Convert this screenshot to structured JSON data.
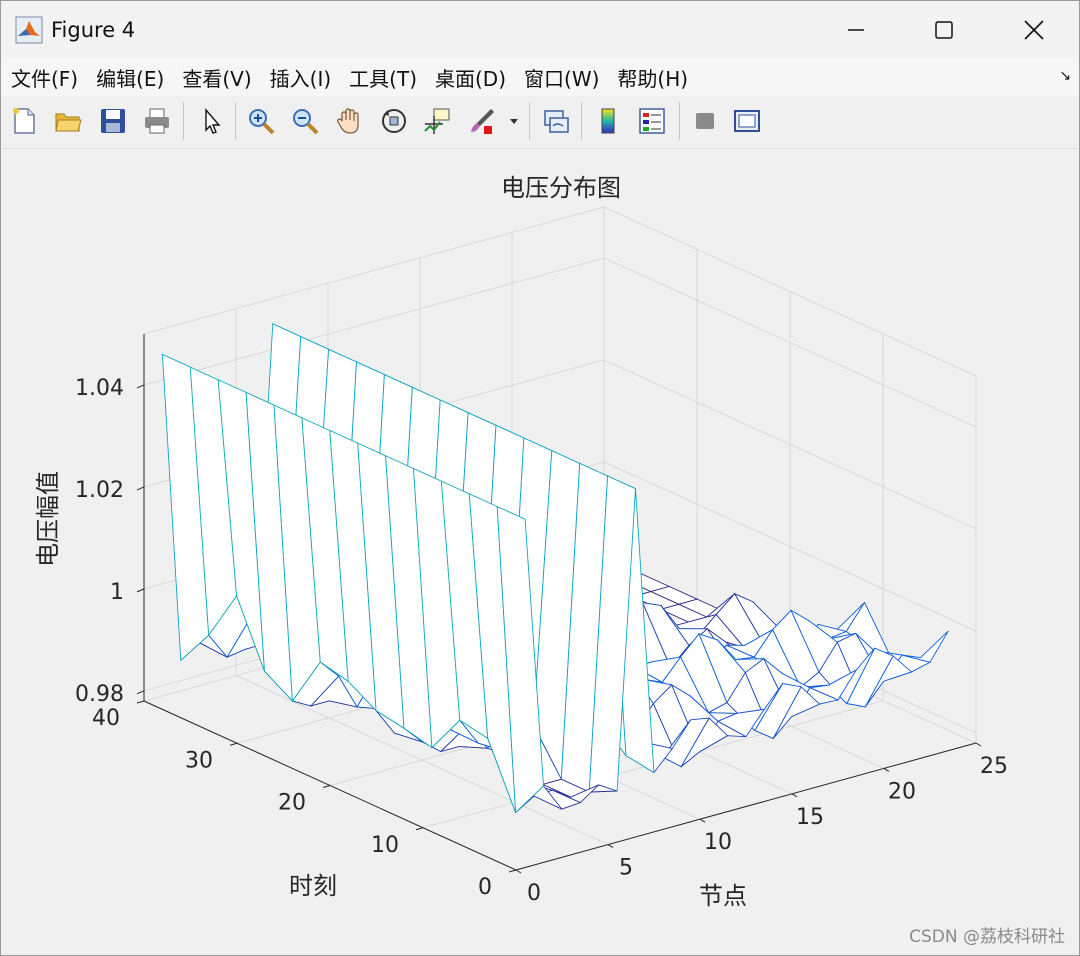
{
  "window": {
    "title": "Figure 4"
  },
  "menu": {
    "items": [
      "文件(F)",
      "编辑(E)",
      "查看(V)",
      "插入(I)",
      "工具(T)",
      "桌面(D)",
      "窗口(W)",
      "帮助(H)"
    ]
  },
  "toolbar": {
    "icons": [
      "new-figure-icon",
      "open-file-icon",
      "save-icon",
      "print-icon",
      "pointer-icon",
      "zoom-in-icon",
      "zoom-out-icon",
      "pan-hand-icon",
      "rotate-3d-icon",
      "data-cursor-icon",
      "brush-icon",
      "link-plot-icon",
      "colorbar-icon",
      "legend-icon",
      "hide-plot-tools-icon",
      "show-plot-tools-icon"
    ]
  },
  "chart_data": {
    "type": "surface-mesh",
    "title": "电压分布图",
    "xlabel": "节点",
    "ylabel": "时刻",
    "zlabel": "电压幅值",
    "xlim": [
      0,
      25
    ],
    "ylim": [
      0,
      40
    ],
    "zlim": [
      0.978,
      1.05
    ],
    "xticks": [
      "0",
      "5",
      "10",
      "15",
      "20",
      "25"
    ],
    "yticks": [
      "0",
      "10",
      "20",
      "30",
      "40"
    ],
    "zticks": [
      "0.98",
      "1",
      "1.02",
      "1.04"
    ],
    "colormap": "parula",
    "grid": true,
    "nodes": [
      1,
      2,
      3,
      4,
      5,
      6,
      7,
      8,
      9,
      10,
      11,
      12,
      13,
      14,
      15,
      16,
      17,
      18,
      19,
      20,
      21,
      22,
      23,
      24
    ],
    "times": [
      1,
      4,
      7,
      10,
      13,
      16,
      19,
      22,
      25,
      28,
      31,
      34,
      37,
      40
    ],
    "description_of_surface": "Voltage rises steeply to about 1.045 at node 1 (source) across all time instants and again at node 7 (second source); elsewhere voltage dips to about 0.985 with periodic daily valleys, and rises toward about 1.04 near node 24 at early times."
  },
  "watermark": "CSDN @荔枝科研社"
}
